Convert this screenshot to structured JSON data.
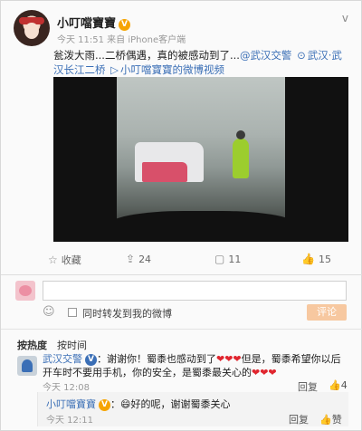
{
  "post": {
    "author": "小叮噹寶寶",
    "verified_badge": "V",
    "menu_chevron": "v",
    "meta": "今天 11:51 来自 iPhone客户端",
    "text_line1": "瓮泼大雨...二桥偶遇，真的被感动到了...",
    "mention": "@武汉交警",
    "location_icon": "⊙",
    "location": "武汉·武汉长江二桥",
    "video_link_icon": "▷",
    "video_link": "小叮噹寶寶的微博视频"
  },
  "actions": {
    "favorite": "收藏",
    "repost_count": "24",
    "comment_count": "11",
    "like_count": "15"
  },
  "comment_box": {
    "placeholder": "",
    "repost_label": "同时转发到我的微博",
    "submit": "评论"
  },
  "sort": {
    "by_hot": "按热度",
    "by_time": "按时间"
  },
  "comments": [
    {
      "author": "武汉交警",
      "verified": "V",
      "text_a": "：谢谢你！蜀黍也感动到了",
      "hearts_a": "❤❤❤",
      "text_b": "但是，蜀黍希望你以后开车时不要用手机，你的安全，是蜀黍最关心的",
      "hearts_b": "❤❤❤",
      "time": "今天 12:08",
      "reply": "回复",
      "likes": "4"
    }
  ],
  "sub_reply": {
    "author": "小叮噹寶寶",
    "verified": "V",
    "text": "：😄好的呢，谢谢蜀黍关心",
    "time": "今天 12:11",
    "reply": "回复",
    "like": "赞"
  }
}
